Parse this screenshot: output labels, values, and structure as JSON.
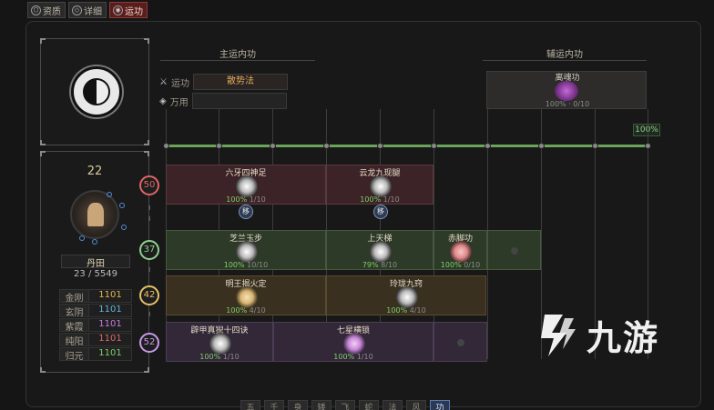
{
  "tabs": [
    {
      "label": "资质",
      "icon": "info-icon",
      "active": false
    },
    {
      "label": "详细",
      "icon": "detail-icon",
      "active": false
    },
    {
      "label": "运功",
      "icon": "cultivate-icon",
      "active": true
    }
  ],
  "main_section": {
    "title": "主运内功"
  },
  "aux_section": {
    "title": "辅运内功"
  },
  "yun": {
    "yungong_label": "运功",
    "yungong_value": "散势法",
    "wanyong_label": "万用",
    "wanyong_value": ""
  },
  "aux_card": {
    "name": "离魂功",
    "progress": "100% · 0/10",
    "pct": "100%"
  },
  "character": {
    "level": "22",
    "dantian_label": "丹田",
    "dantian_value": "23 / 5549",
    "stats": [
      {
        "name": "金刚",
        "value": "1101",
        "color": "#e5b54a"
      },
      {
        "name": "玄阴",
        "value": "1101",
        "color": "#62b6e0"
      },
      {
        "name": "紫霞",
        "value": "1101",
        "color": "#c57be0"
      },
      {
        "name": "纯阳",
        "value": "1101",
        "color": "#e06a6a"
      },
      {
        "name": "归元",
        "value": "1101",
        "color": "#7fcf6a"
      }
    ]
  },
  "rows": [
    {
      "level": "50",
      "color": "#e06565",
      "bg": "#3c2327",
      "cells": [
        {
          "name": "六牙四神足",
          "progress_green": "100%",
          "progress_rest": " 1/10"
        },
        {
          "name": "云龙九现腿",
          "progress_green": "100%",
          "progress_rest": " 1/10"
        }
      ],
      "moves": [
        "移",
        "移"
      ]
    },
    {
      "level": "37",
      "color": "#8fd08f",
      "bg": "#2d3a28",
      "cells": [
        {
          "name": "芝兰玉步",
          "progress_green": "100%",
          "progress_rest": " 10/10"
        },
        {
          "name": "上天梯",
          "progress_green": "79%",
          "progress_rest": " 8/10"
        },
        {
          "name": "赤脚功",
          "progress_green": "100%",
          "progress_rest": " 0/10"
        }
      ]
    },
    {
      "level": "42",
      "color": "#e5c06a",
      "bg": "#3a3020",
      "cells": [
        {
          "name": "明王揭火定",
          "progress_green": "100%",
          "progress_rest": " 4/10"
        },
        {
          "name": "玲珑九窍",
          "progress_green": "100%",
          "progress_rest": " 4/10"
        }
      ]
    },
    {
      "level": "52",
      "color": "#c898e8",
      "bg": "#322838",
      "cells": [
        {
          "name": "辟甲真猊十四诀",
          "progress_green": "100%",
          "progress_rest": " 1/10"
        },
        {
          "name": "七星横锁",
          "progress_green": "100%",
          "progress_rest": " 1/10"
        }
      ]
    }
  ],
  "bottom_chips": [
    "五",
    "千",
    "身",
    "矮",
    "飞",
    "蛇",
    "法",
    "风",
    "功"
  ],
  "watermark": {
    "text": "九游"
  }
}
